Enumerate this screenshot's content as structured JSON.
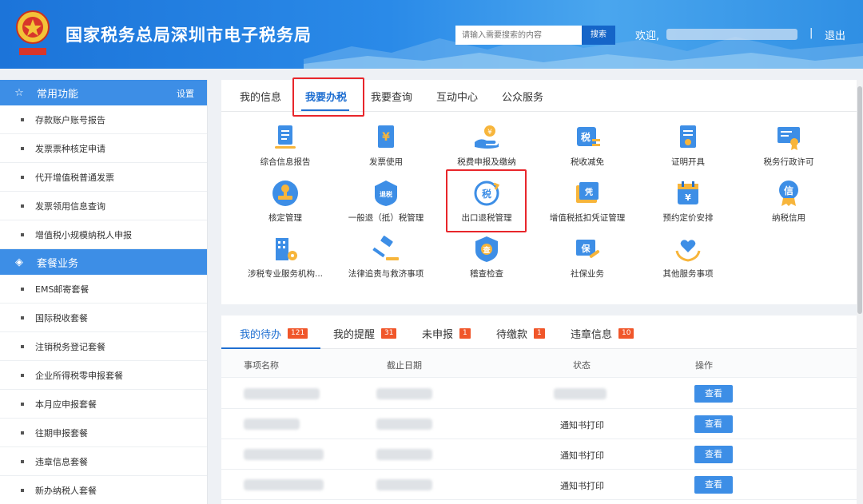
{
  "header": {
    "title": "国家税务总局深圳市电子税务局",
    "search_placeholder": "请输入需要搜索的内容",
    "search_button": "搜索",
    "welcome": "欢迎,",
    "separator": "|",
    "logout": "退出",
    "brand_color": "#1c74d9"
  },
  "sidebar": {
    "common_title": "常用功能",
    "settings": "设置",
    "common_items": [
      "存款账户账号报告",
      "发票票种核定申请",
      "代开增值税普通发票",
      "发票领用信息查询",
      "增值税小规模纳税人申报"
    ],
    "package_title": "套餐业务",
    "package_items": [
      "EMS邮寄套餐",
      "国际税收套餐",
      "注销税务登记套餐",
      "企业所得税零申报套餐",
      "本月应申报套餐",
      "往期申报套餐",
      "违章信息套餐",
      "新办纳税人套餐"
    ]
  },
  "main_tabs": [
    "我的信息",
    "我要办税",
    "我要查询",
    "互动中心",
    "公众服务"
  ],
  "services": [
    {
      "label": "综合信息报告",
      "icon": "report-doc-icon"
    },
    {
      "label": "发票使用",
      "icon": "invoice-yuan-icon"
    },
    {
      "label": "税费申报及缴纳",
      "icon": "hand-coin-icon"
    },
    {
      "label": "税收减免",
      "icon": "tax-reduce-icon"
    },
    {
      "label": "证明开具",
      "icon": "certificate-icon"
    },
    {
      "label": "税务行政许可",
      "icon": "license-award-icon"
    },
    {
      "label": "核定管理",
      "icon": "stamp-icon"
    },
    {
      "label": "一般退（抵）税管理",
      "icon": "refund-shield-icon"
    },
    {
      "label": "出口退税管理",
      "icon": "export-refund-icon"
    },
    {
      "label": "增值税抵扣凭证管理",
      "icon": "voucher-icon"
    },
    {
      "label": "预约定价安排",
      "icon": "calendar-yuan-icon"
    },
    {
      "label": "纳税信用",
      "icon": "credit-medal-icon"
    },
    {
      "label": "涉税专业服务机构...",
      "icon": "building-gear-icon"
    },
    {
      "label": "法律追责与救济事项",
      "icon": "gavel-icon"
    },
    {
      "label": "稽查检查",
      "icon": "inspect-shield-icon"
    },
    {
      "label": "社保业务",
      "icon": "social-security-icon"
    },
    {
      "label": "其他服务事项",
      "icon": "heart-hands-icon"
    }
  ],
  "todo_tabs": [
    {
      "label": "我的待办",
      "count": "121"
    },
    {
      "label": "我的提醒",
      "count": "31"
    },
    {
      "label": "未申报",
      "count": "1"
    },
    {
      "label": "待缴款",
      "count": "1"
    },
    {
      "label": "违章信息",
      "count": "10"
    }
  ],
  "table": {
    "headers": [
      "事项名称",
      "截止日期",
      "状态",
      "操作"
    ],
    "rows": [
      {
        "status": "",
        "action": "查看"
      },
      {
        "status": "通知书打印",
        "action": "查看"
      },
      {
        "status": "通知书打印",
        "action": "查看"
      },
      {
        "status": "通知书打印",
        "action": "查看"
      }
    ]
  }
}
